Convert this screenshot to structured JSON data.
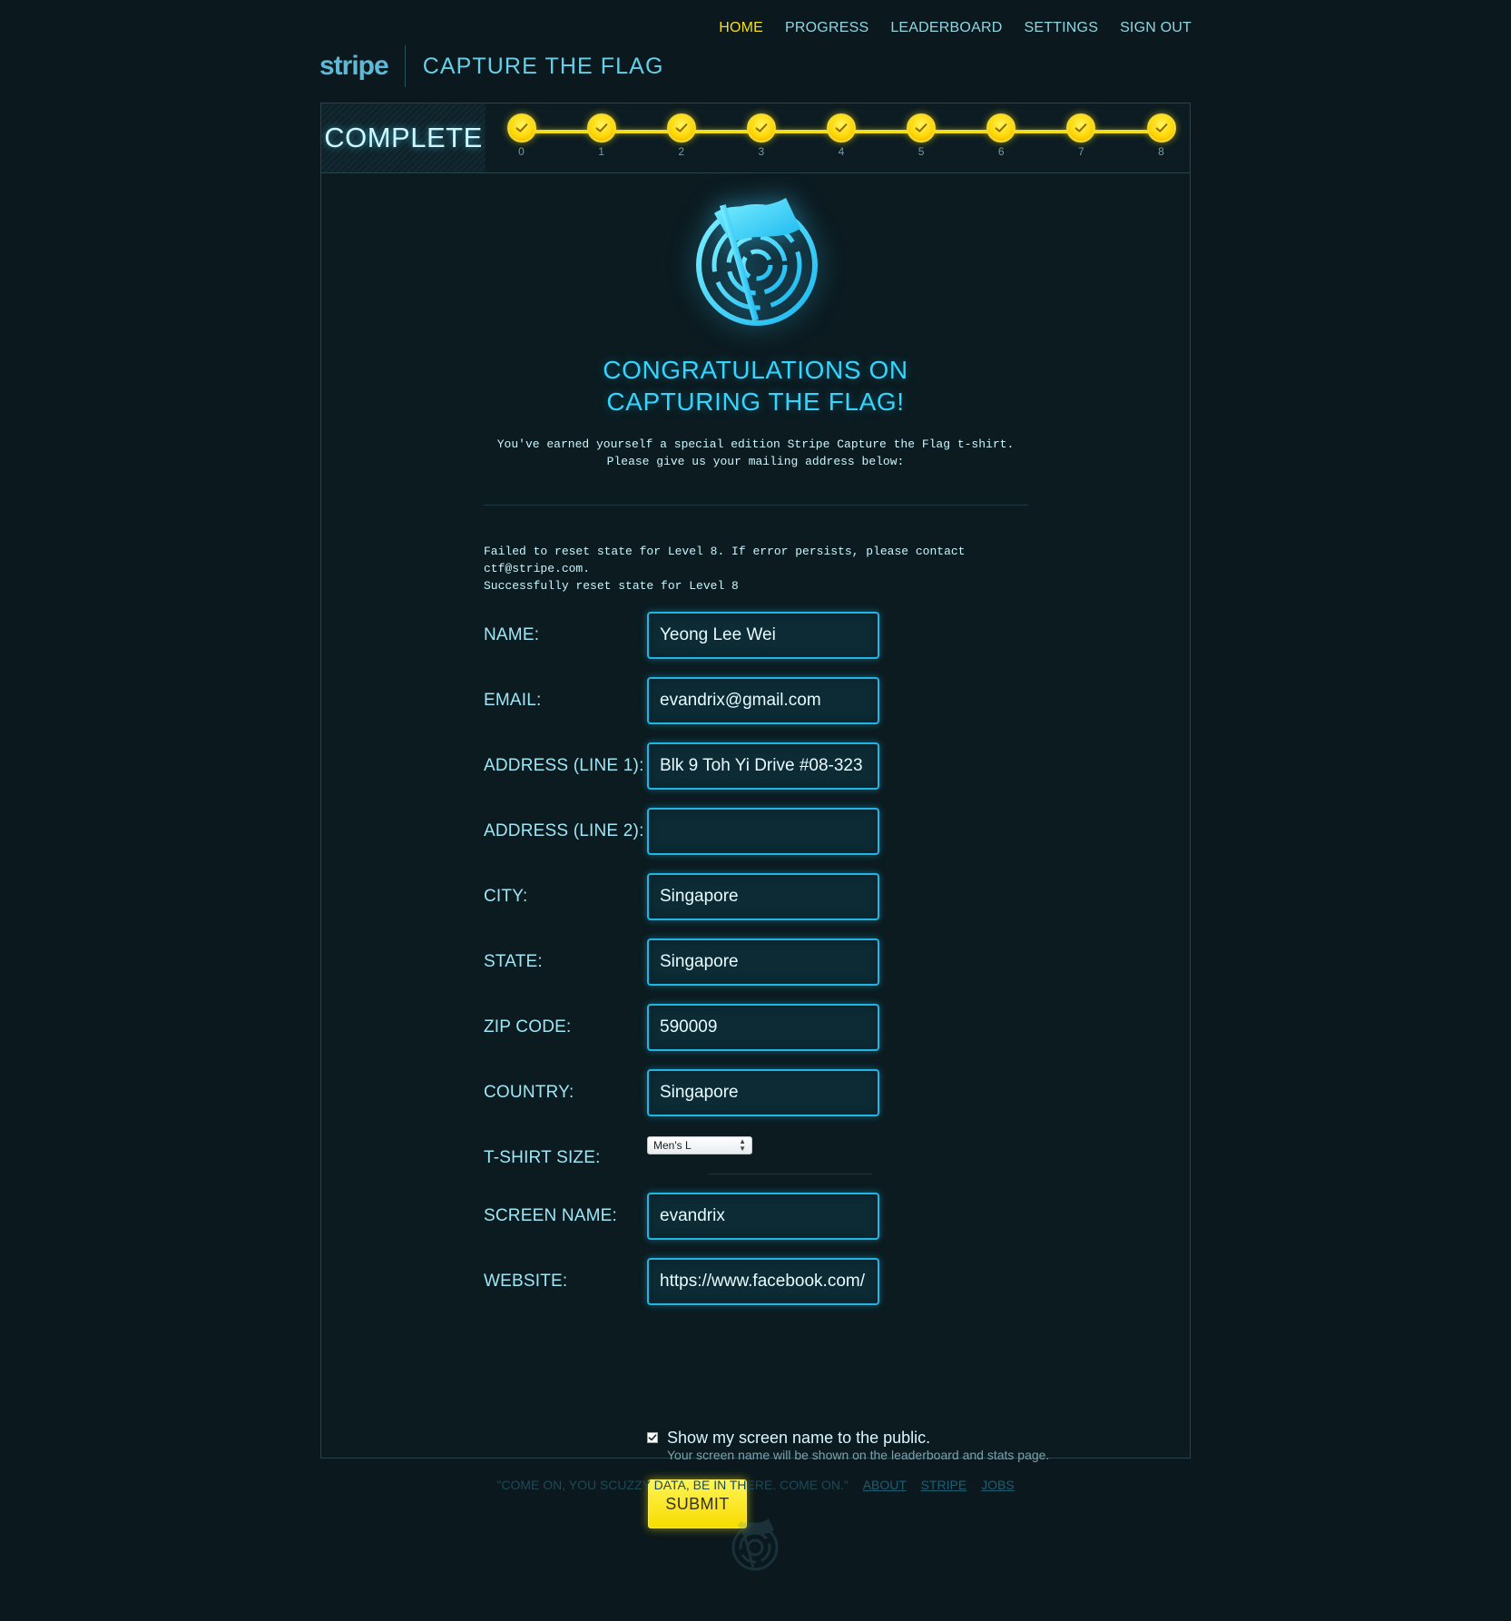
{
  "nav": {
    "items": [
      "HOME",
      "PROGRESS",
      "LEADERBOARD",
      "SETTINGS",
      "SIGN OUT"
    ]
  },
  "brand": {
    "logo": "stripe",
    "title": "CAPTURE THE FLAG"
  },
  "progress": {
    "status_label": "COMPLETE",
    "levels": [
      "0",
      "1",
      "2",
      "3",
      "4",
      "5",
      "6",
      "7",
      "8"
    ],
    "completed_levels": 9
  },
  "main": {
    "headline_line1": "CONGRATULATIONS ON",
    "headline_line2": "CAPTURING THE FLAG!",
    "subtitle_line1": "You've earned yourself a special edition Stripe Capture the Flag t-shirt.",
    "subtitle_line2": "Please give us your mailing address below:",
    "status_line1": "Failed to reset state for Level 8. If error persists, please contact",
    "status_line2": "ctf@stripe.com.",
    "status_line3": "Successfully reset state for Level 8"
  },
  "form": {
    "name": {
      "label": "NAME:",
      "value": "Yeong Lee Wei"
    },
    "email": {
      "label": "EMAIL:",
      "value": "evandrix@gmail.com"
    },
    "address1": {
      "label": "ADDRESS (LINE 1):",
      "value": "Blk 9 Toh Yi Drive #08-323"
    },
    "address2": {
      "label": "ADDRESS (LINE 2):",
      "value": ""
    },
    "city": {
      "label": "CITY:",
      "value": "Singapore"
    },
    "state": {
      "label": "STATE:",
      "value": "Singapore"
    },
    "zip": {
      "label": "ZIP CODE:",
      "value": "590009"
    },
    "country": {
      "label": "COUNTRY:",
      "value": "Singapore"
    },
    "tshirt": {
      "label": "T-SHIRT SIZE:",
      "value": "Men's L"
    },
    "screen_name": {
      "label": "SCREEN NAME:",
      "value": "evandrix"
    },
    "website": {
      "label": "WEBSITE:",
      "value": "https://www.facebook.com/"
    },
    "public_checkbox": {
      "label": "Show my screen name to the public.",
      "hint": "Your screen name will be shown on the leaderboard and stats page."
    },
    "submit_label": "SUBMIT"
  },
  "footer": {
    "quote": "\"COME ON, YOU SCUZZY DATA, BE IN THERE. COME ON.\"",
    "links": [
      "ABOUT",
      "STRIPE",
      "JOBS"
    ]
  },
  "colors": {
    "accent": "#37d4ff",
    "highlight": "#f4df1f",
    "background": "#0b181d"
  },
  "icons": {
    "level_marker": "check-icon",
    "hero": "flag-emblem-icon",
    "footer": "flag-emblem-icon"
  }
}
